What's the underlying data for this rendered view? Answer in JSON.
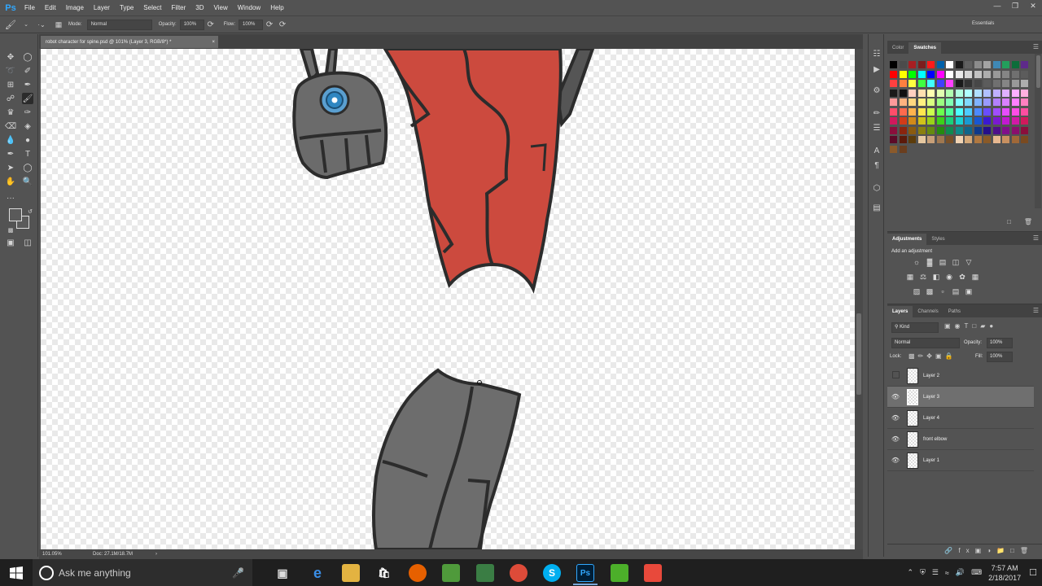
{
  "app": {
    "logo": "Ps",
    "menus": [
      "File",
      "Edit",
      "Image",
      "Layer",
      "Type",
      "Select",
      "Filter",
      "3D",
      "View",
      "Window",
      "Help"
    ],
    "window_controls": [
      "minimize",
      "restore",
      "close"
    ]
  },
  "options": {
    "mode_label": "Mode:",
    "mode_value": "Normal",
    "opacity_label": "Opacity:",
    "opacity_value": "100%",
    "flow_label": "Flow:",
    "flow_value": "100%",
    "workspace": "Essentials"
  },
  "document": {
    "tab_title": "robot character for spine.psd @ 101% (Layer 3, RGB/8*) *",
    "tab_close": "×",
    "zoom": "101.05%",
    "doc_info": "Doc: 27.1M/18.7M"
  },
  "swatches_panel": {
    "tabs": [
      "Color",
      "Swatches"
    ],
    "active_tab": "Swatches",
    "colors": [
      [
        "#000000",
        "#4b4b4b",
        "#a71e22",
        "#7c1d1d",
        "#ff1a1a",
        "#0061aa",
        "#ffffff",
        "#1a1a1a",
        "#616161",
        "#8c8c8c",
        "#a4a4a4",
        "#3f88b5",
        "#239f5c",
        "#0c6d3a",
        "#5e2a8a"
      ],
      [
        "#ff0000",
        "#ffff00",
        "#00ff00",
        "#00ffff",
        "#0000ff",
        "#ff00ff",
        "#ffffff",
        "#ebebeb",
        "#d6d6d6",
        "#c2c2c2",
        "#adadad",
        "#999999",
        "#858585",
        "#707070",
        "#5c5c5c"
      ],
      [
        "#ff4040",
        "#ff8040",
        "#ffff40",
        "#40ff40",
        "#40ffff",
        "#4040ff",
        "#ff40ff",
        "#1a1a1a",
        "#333333",
        "#474747",
        "#5c5c5c",
        "#707070",
        "#858585",
        "#999999",
        "#adadad"
      ],
      [
        "#1a1a1a",
        "#111111",
        "#ffd0c0",
        "#ffe0b0",
        "#ffffb0",
        "#e0ffb0",
        "#b0ffb0",
        "#b0ffe0",
        "#b0ffff",
        "#b0e0ff",
        "#b0c0ff",
        "#c0b0ff",
        "#e0b0ff",
        "#ffb0ff",
        "#ffb0e0"
      ],
      [
        "#ff9a9a",
        "#ffb380",
        "#ffd780",
        "#fff080",
        "#d9ff80",
        "#9aff80",
        "#80ffb3",
        "#80ffff",
        "#80d9ff",
        "#80b3ff",
        "#9a9aff",
        "#b380ff",
        "#d980ff",
        "#ff80ff",
        "#ff80c0"
      ],
      [
        "#ff4d6a",
        "#ff6a4d",
        "#ffb34d",
        "#ffe64d",
        "#ccff4d",
        "#6aff4d",
        "#4dffa0",
        "#4dffff",
        "#4dccff",
        "#4d8aff",
        "#6a4dff",
        "#a04dff",
        "#e64dff",
        "#ff4de6",
        "#ff4da0"
      ],
      [
        "#d1195c",
        "#d13b19",
        "#d18a19",
        "#d1c219",
        "#9ad119",
        "#3bd119",
        "#19d17a",
        "#19d1d1",
        "#199ad1",
        "#1957d1",
        "#3b19d1",
        "#7a19d1",
        "#c219d1",
        "#d119a6",
        "#d1195c"
      ],
      [
        "#8a0f3c",
        "#8a250f",
        "#8a5b0f",
        "#8a800f",
        "#658a0f",
        "#258a0f",
        "#0f8a4f",
        "#0f8a8a",
        "#0f658a",
        "#0f398a",
        "#250f8a",
        "#4f0f8a",
        "#800f8a",
        "#8a0f6d",
        "#8a0f3c"
      ],
      [
        "#5c0a28",
        "#5c1a0a",
        "#5c3c0a",
        "#e6c8a0",
        "#c8a078",
        "#a07850",
        "#785028",
        "#f2d4b4",
        "#d4a878",
        "#b07840",
        "#8a5a28",
        "#e8b890",
        "#c89060",
        "#a06838",
        "#7a4a20"
      ],
      [
        "#8b5a2b",
        "#6b3e1e"
      ]
    ]
  },
  "adjustments_panel": {
    "tabs": [
      "Adjustments",
      "Styles"
    ],
    "active_tab": "Adjustments",
    "heading": "Add an adjustment"
  },
  "layers_panel": {
    "tabs": [
      "Layers",
      "Channels",
      "Paths"
    ],
    "active_tab": "Layers",
    "filter_kind": "Kind",
    "blend_mode": "Normal",
    "opacity_label": "Opacity:",
    "opacity_value": "100%",
    "lock_label": "Lock:",
    "fill_label": "Fill:",
    "fill_value": "100%",
    "layers": [
      {
        "name": "Layer 2",
        "visible": false,
        "selected": false
      },
      {
        "name": "Layer 3",
        "visible": true,
        "selected": true
      },
      {
        "name": "Layer 4",
        "visible": true,
        "selected": false
      },
      {
        "name": "front elbow",
        "visible": true,
        "selected": false
      },
      {
        "name": "Layer 1",
        "visible": true,
        "selected": false
      }
    ]
  },
  "taskbar": {
    "search_placeholder": "Ask me anything",
    "time": "7:57 AM",
    "date": "2/18/2017"
  },
  "colors": {
    "accent": "#31a8ff",
    "robot_red": "#cc4a3e",
    "robot_gray": "#6f6f6f",
    "eye_blue": "#2f86c1"
  }
}
